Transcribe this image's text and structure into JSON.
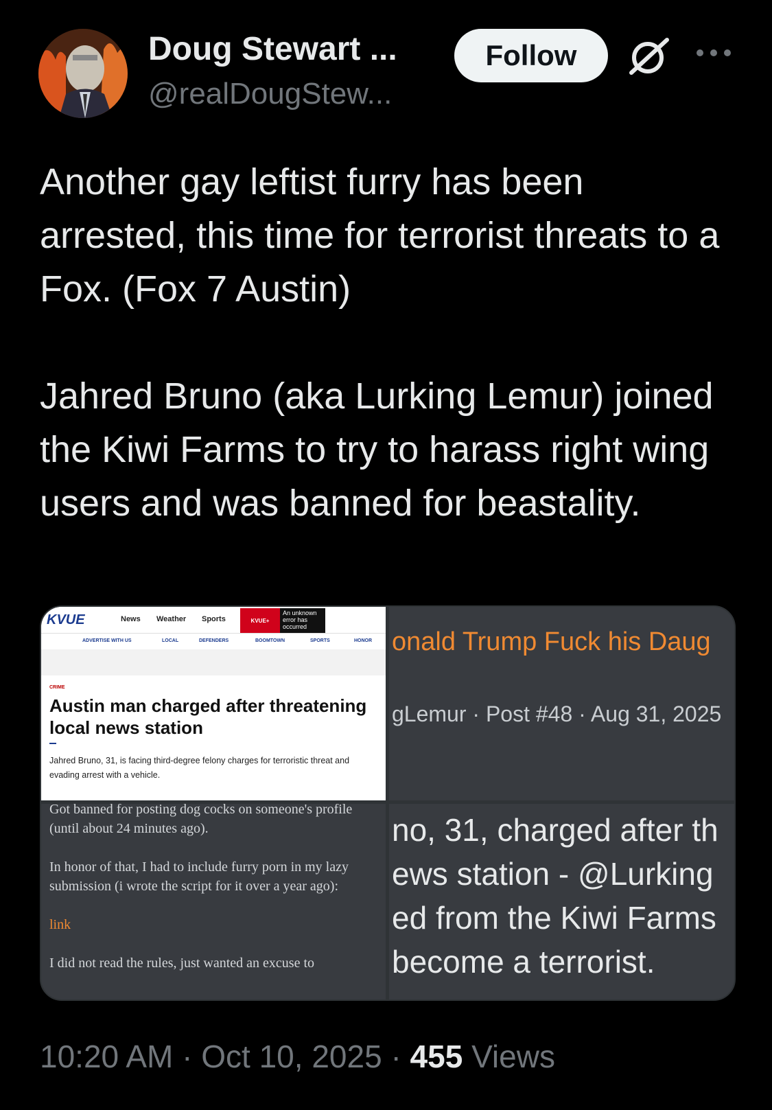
{
  "author": {
    "display_name": "Doug Stewart ...",
    "handle": "@realDougStew..."
  },
  "actions": {
    "follow_label": "Follow"
  },
  "tweet": {
    "text": "Another gay leftist furry has been arrested, this time for terrorist threats to a Fox. (Fox 7 Austin)\n\nJahred Bruno (aka Lurking Lemur) joined the Kiwi Farms to try to harass right wing users and was banned for beastality."
  },
  "media": {
    "tile1": {
      "logo": "KVUE",
      "nav": [
        "News",
        "Weather",
        "Sports"
      ],
      "plus": "KVUE+",
      "error": "An unknown error has occurred",
      "subnav": [
        "ADVERTISE WITH US",
        "LOCAL",
        "DEFENDERS",
        "BOOMTOWN",
        "SPORTS",
        "HONOR"
      ],
      "category": "CRIME",
      "headline": "Austin man charged after threatening local news station",
      "description": "Jahred Bruno, 31, is facing third-degree felony charges for terroristic threat and evading arrest with a vehicle."
    },
    "tile2": {
      "title": "onald Trump Fuck his Daug",
      "meta": "gLemur · Post #48 · Aug 31, 2025"
    },
    "tile3": {
      "p1": "Got banned for posting dog cocks on someone's profile (until about 24 minutes ago).",
      "p2": "In honor of that, I had to include furry porn in my lazy submission (i wrote the script for it over a year ago):",
      "link": "link",
      "p3": "I did not read the rules, just wanted an excuse to"
    },
    "tile4": {
      "text": "no, 31, charged after th\news station - @Lurking\ned from the Kiwi Farms\nbecome a terrorist."
    }
  },
  "footer": {
    "time": "10:20 AM",
    "date": "Oct 10, 2025",
    "views_count": "455",
    "views_label": "Views"
  }
}
